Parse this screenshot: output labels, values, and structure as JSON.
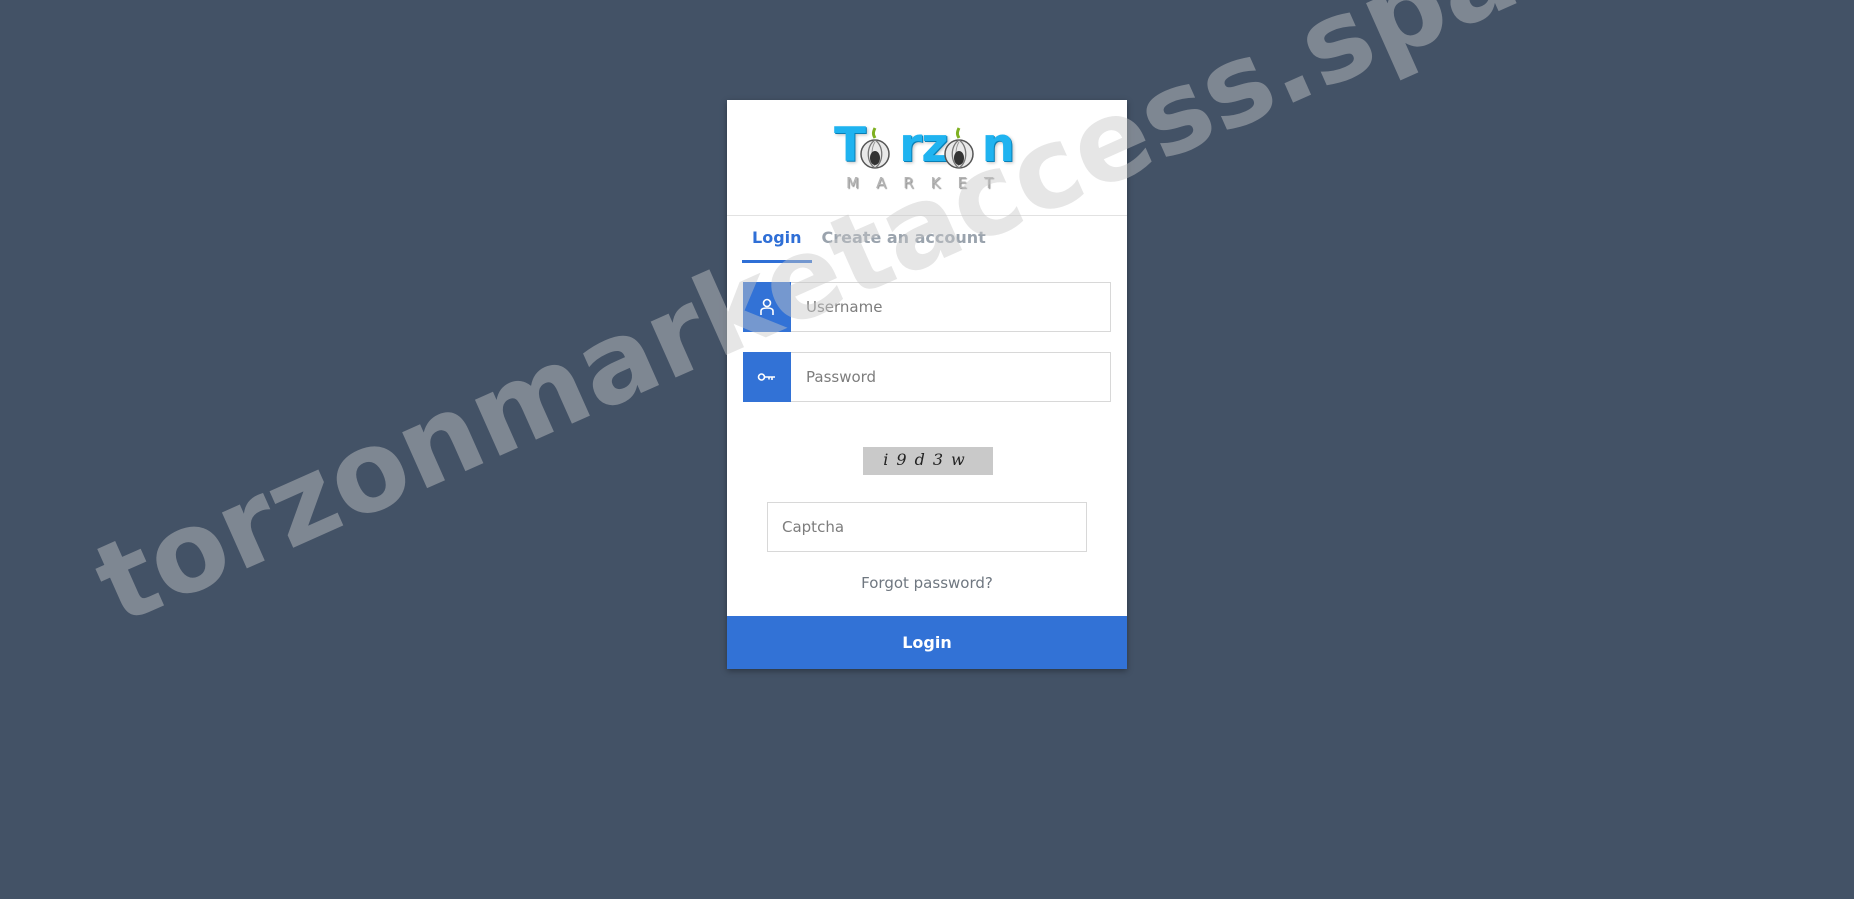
{
  "logo": {
    "word_part1": "T",
    "word_part2": "rz",
    "word_part3": "n",
    "subtitle": "MARKET",
    "colors": {
      "primary": "#1fb3f0",
      "subtitle": "#b5b5b5"
    }
  },
  "tabs": [
    {
      "label": "Login",
      "active": true
    },
    {
      "label": "Create an account",
      "active": false
    }
  ],
  "form": {
    "username": {
      "placeholder": "Username",
      "value": "",
      "icon": "user-icon"
    },
    "password": {
      "placeholder": "Password",
      "value": "",
      "icon": "key-icon"
    },
    "captcha_image_text": "i9d3w",
    "captcha": {
      "placeholder": "Captcha",
      "value": ""
    },
    "forgot_password": "Forgot password?",
    "submit_label": "Login"
  },
  "watermark": "torzonmarketaccess.space",
  "colors": {
    "background": "#435266",
    "accent": "#3272d6",
    "card": "#ffffff"
  }
}
